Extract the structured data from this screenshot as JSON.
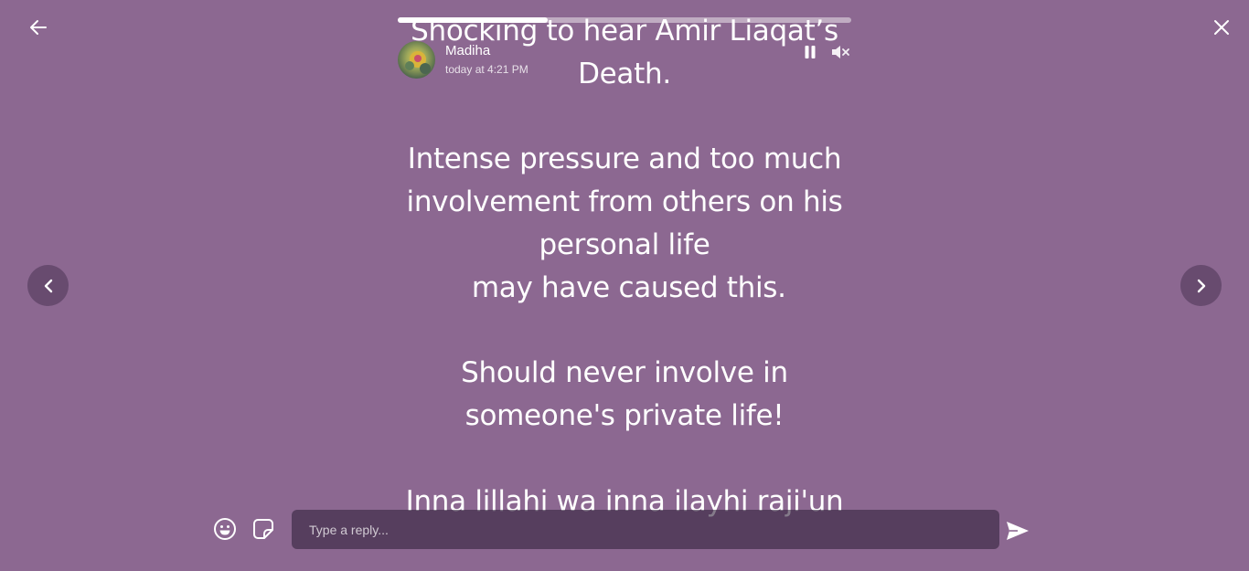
{
  "story": {
    "text": "Shocking to hear Amir Liaqat’s Death.\n\nIntense pressure and too much involvement from others on his personal life\n may have caused this.\n\nShould never involve in someone's private life!\n\nInna lillahi wa inna ilayhi raji'un",
    "background_color": "#8c6891",
    "progress": [
      {
        "fill": 0.33
      },
      {
        "fill": 0
      }
    ]
  },
  "author": {
    "name": "Madiha",
    "time": "today at 4:21 PM"
  },
  "icons": {
    "back": "arrow-left-icon",
    "close": "close-icon",
    "pause": "pause-icon",
    "mute": "volume-muted-icon",
    "prev": "chevron-left-icon",
    "next": "chevron-right-icon",
    "emoji": "smiley-icon",
    "sticker": "sticker-icon",
    "send": "send-icon"
  },
  "reply": {
    "placeholder": "Type a reply...",
    "value": ""
  }
}
